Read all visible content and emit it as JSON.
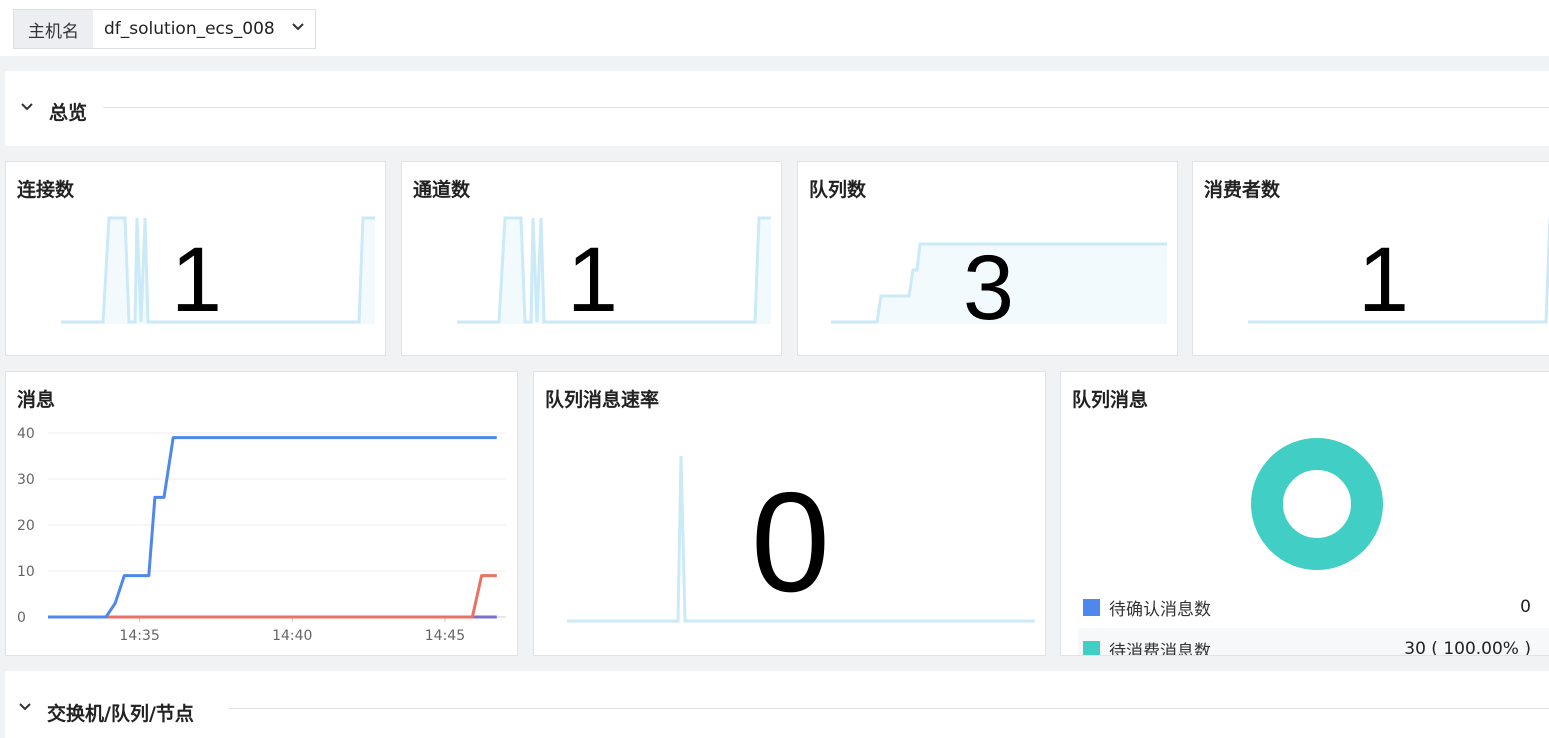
{
  "filter": {
    "label": "主机名",
    "value": "df_solution_ecs_008"
  },
  "sections": {
    "overview": "总览",
    "exchange": "交换机/队列/节点"
  },
  "stats": [
    {
      "title": "连接数",
      "value": "1"
    },
    {
      "title": "通道数",
      "value": "1"
    },
    {
      "title": "队列数",
      "value": "3"
    },
    {
      "title": "消费者数",
      "value": "1"
    }
  ],
  "rate_card": {
    "title": "队列消息速率",
    "value": "0"
  },
  "messages_chart": {
    "title": "消息",
    "chart_data": {
      "type": "line",
      "x": [
        "14:32",
        "14:33",
        "14:34",
        "14:35",
        "14:36",
        "14:37",
        "14:38",
        "14:39",
        "14:40",
        "14:41",
        "14:42",
        "14:43",
        "14:44",
        "14:45",
        "14:46",
        "14:47"
      ],
      "x_ticks": [
        "14:35",
        "14:40",
        "14:45"
      ],
      "y_ticks": [
        "0",
        "10",
        "20",
        "30",
        "40"
      ],
      "ylim": [
        0,
        40
      ],
      "series": [
        {
          "color": "#4e88ec",
          "points": [
            [
              0,
              0
            ],
            [
              1.9,
              0
            ],
            [
              2.2,
              3
            ],
            [
              2.5,
              9
            ],
            [
              3.3,
              9
            ],
            [
              3.5,
              26
            ],
            [
              3.8,
              26
            ],
            [
              4.1,
              39
            ],
            [
              14.7,
              39
            ]
          ]
        },
        {
          "color": "#ec7063",
          "points": [
            [
              0,
              0
            ],
            [
              13.9,
              0
            ],
            [
              14.2,
              9
            ],
            [
              14.7,
              9
            ]
          ]
        },
        {
          "color": "#7b6fd0",
          "points": [
            [
              0,
              0
            ],
            [
              14.7,
              0
            ]
          ]
        }
      ]
    }
  },
  "queue_messages": {
    "title": "队列消息",
    "chart_data": {
      "type": "pie",
      "slices": [
        {
          "name": "待确认消息数",
          "value": 0,
          "display": "0",
          "color": "#4e88ec"
        },
        {
          "name": "待消费消息数",
          "value": 30,
          "display": "30 ( 100.00% )",
          "color": "#40cec5"
        }
      ]
    }
  },
  "colors": {
    "spark_line": "#cbeaf7",
    "spark_fill": "#f3fafe",
    "donut": "#40cec5"
  }
}
